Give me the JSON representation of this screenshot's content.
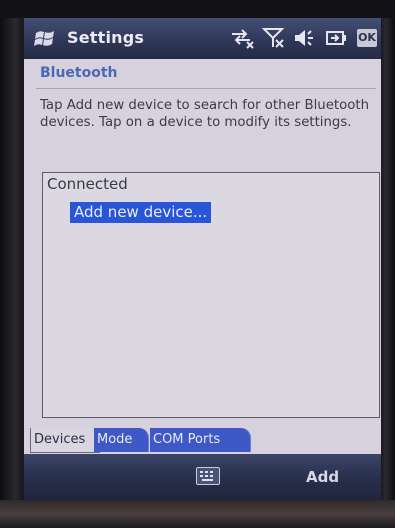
{
  "titlebar": {
    "title": "Settings",
    "status_icons": [
      "connectivity-icon",
      "signal-off-icon",
      "speaker-muted-icon",
      "battery-icon"
    ],
    "ok_label": "OK"
  },
  "page": {
    "header": "Bluetooth",
    "instructions": "Tap Add new device to search for other Bluetooth devices. Tap on a device to modify its settings."
  },
  "device_list": {
    "group_header": "Connected",
    "items": [
      {
        "label": "Add new device..."
      }
    ]
  },
  "tabs": [
    {
      "label": "Devices",
      "active": true
    },
    {
      "label": "Mode",
      "active": false
    },
    {
      "label": "COM Ports",
      "active": false
    }
  ],
  "menubar": {
    "keyboard_icon": "keyboard-icon",
    "right_softkey": "Add"
  },
  "colors": {
    "selection": "#2a55d6",
    "header_text": "#4c68b5",
    "titlebar": "#2e3656"
  }
}
